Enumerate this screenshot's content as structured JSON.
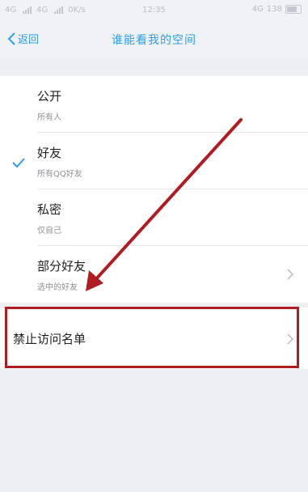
{
  "status_bar": {
    "net1": "4G",
    "net2": "4G",
    "speed": "0K/s",
    "time": "12:35",
    "right_net": "4G",
    "battery": "138"
  },
  "nav": {
    "back_label": "返回",
    "title": "谁能看我的空间"
  },
  "options": [
    {
      "name": "公开",
      "sub": "所有人",
      "selected": false,
      "chevron": false
    },
    {
      "name": "好友",
      "sub": "所有QQ好友",
      "selected": true,
      "chevron": false
    },
    {
      "name": "私密",
      "sub": "仅自己",
      "selected": false,
      "chevron": false
    },
    {
      "name": "部分好友",
      "sub": "选中的好友",
      "selected": false,
      "chevron": true
    }
  ],
  "banned_list": {
    "label": "禁止访问名单"
  },
  "colors": {
    "accent": "#2a9ef0",
    "annotation_red": "#b01c22"
  }
}
